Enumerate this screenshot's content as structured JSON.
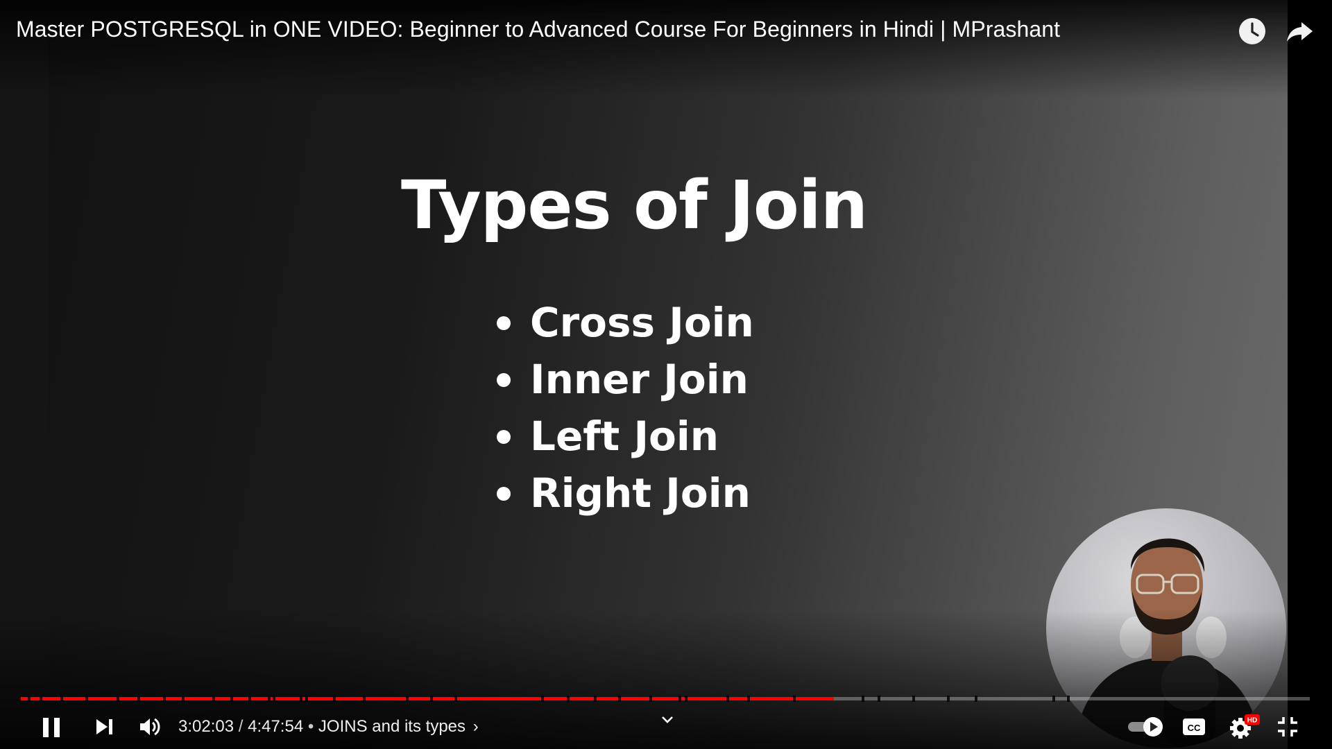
{
  "video": {
    "title": "Master POSTGRESQL in ONE VIDEO: Beginner to Advanced Course For Beginners in Hindi | MPrashant",
    "slide": {
      "heading": "Types of Join",
      "items": [
        "Cross Join",
        "Inner Join",
        "Left Join",
        "Right Join"
      ]
    }
  },
  "player": {
    "current_time": "3:02:03",
    "duration": "4:47:54",
    "time_separator": " / ",
    "bullet": " • ",
    "chapter": "JOINS and its types",
    "chapter_chevron": "›",
    "progress_fraction": 0.631,
    "quality_badge": "HD",
    "cc_label": "CC",
    "accent_color": "#ff0000"
  },
  "icons": {
    "watch_later": "clock-icon",
    "share": "share-icon",
    "pause": "pause-icon",
    "next": "next-icon",
    "volume": "volume-icon",
    "expand": "chevron-down-icon",
    "autoplay": "autoplay-toggle-icon",
    "captions": "cc-icon",
    "settings": "gear-icon",
    "exit_fullscreen": "exit-fullscreen-icon"
  }
}
